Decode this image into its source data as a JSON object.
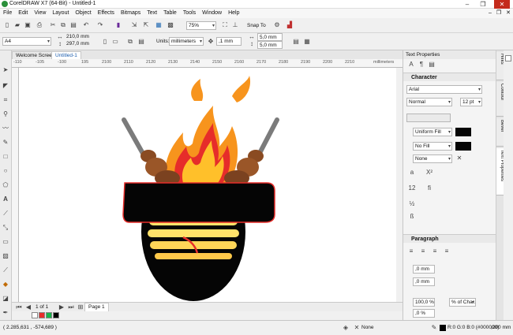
{
  "window": {
    "title": "CorelDRAW X7 (64-Bit) - Untitled-1"
  },
  "menu": [
    "File",
    "Edit",
    "View",
    "Layout",
    "Object",
    "Effects",
    "Bitmaps",
    "Text",
    "Table",
    "Tools",
    "Window",
    "Help"
  ],
  "toolbar1": {
    "zoom": "75%",
    "snap": "Snap To"
  },
  "toolbar2": {
    "page_size": "A4",
    "width": "210,0 mm",
    "height": "297,0 mm",
    "units_label": "Units:",
    "units": "millimeters",
    "nudge": ",1 mm",
    "dup_x": "5,0 mm",
    "dup_y": "5,0 mm"
  },
  "doc_tabs": [
    "Welcome Screen",
    "Untitled-1"
  ],
  "ruler": {
    "ticks": [
      "-110",
      "-105",
      "-100",
      "195",
      "2100",
      "2110",
      "2120",
      "2130",
      "2140",
      "2150",
      "2160",
      "2170",
      "2180",
      "2190",
      "2200",
      "2210"
    ],
    "unit": "millimeters"
  },
  "pagebar": {
    "page_count": "1 of 1",
    "page_tab": "Page 1"
  },
  "docker": {
    "title": "Text Properties",
    "character": {
      "header": "Character",
      "font": "Arial",
      "style": "Normal",
      "size": "12 pt",
      "fill": "Uniform Fill",
      "bg_fill": "No Fill",
      "outline": "None"
    },
    "paragraph": {
      "header": "Paragraph",
      "indent1": ",0 mm",
      "indent2": ",0 mm",
      "indent3": ",0 mm",
      "line_spacing": "100,0 %",
      "char_spacing_unit": "% of Char...",
      "before": ",0 %"
    }
  },
  "side_tabs": [
    "Hints",
    "Contour",
    "Bevel",
    "Text Properties"
  ],
  "status": {
    "coords": "( 2.285,631 , -574,689 )",
    "fill_none": "None",
    "outline_color": "R:0 G:0 B:0 (#000000)",
    "outline_width": ",200 mm"
  },
  "colors": {
    "accent": "#1e5fae",
    "flame_outer": "#f7941d",
    "flame_inner": "#e62d2a",
    "stripe": "#ffe26a",
    "brown": "#8a4b22",
    "black": "#050505"
  }
}
